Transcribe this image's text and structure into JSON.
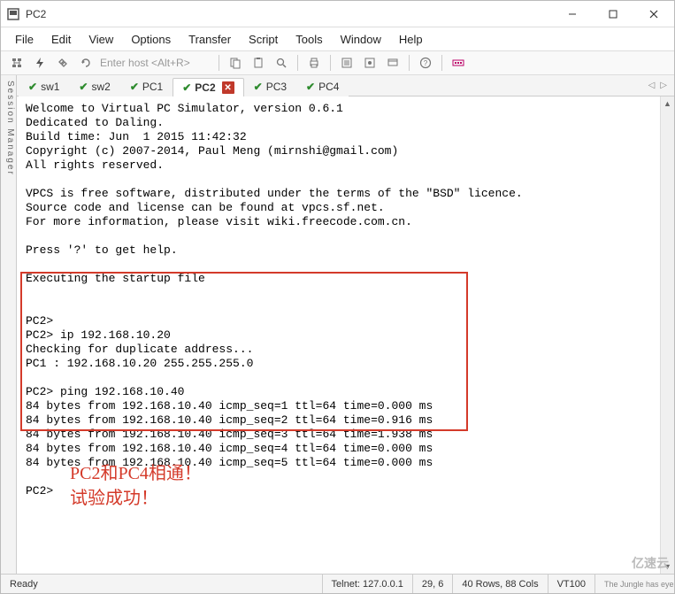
{
  "window": {
    "title": "PC2",
    "buttons": {
      "min": "min",
      "max": "max",
      "close": "close"
    }
  },
  "menu": {
    "items": [
      "File",
      "Edit",
      "View",
      "Options",
      "Transfer",
      "Script",
      "Tools",
      "Window",
      "Help"
    ]
  },
  "toolbar": {
    "host_placeholder": "Enter host <Alt+R>",
    "icons": [
      "session-tree",
      "lightning",
      "disconnect",
      "reconnect"
    ]
  },
  "session_manager_label": "Session Manager",
  "tabs": [
    {
      "label": "sw1",
      "check": true,
      "active": false,
      "close": false
    },
    {
      "label": "sw2",
      "check": true,
      "active": false,
      "close": false
    },
    {
      "label": "PC1",
      "check": true,
      "active": false,
      "close": false
    },
    {
      "label": "PC2",
      "check": true,
      "active": true,
      "close": true
    },
    {
      "label": "PC3",
      "check": true,
      "active": false,
      "close": false
    },
    {
      "label": "PC4",
      "check": true,
      "active": false,
      "close": false
    }
  ],
  "terminal": {
    "text": "Welcome to Virtual PC Simulator, version 0.6.1\nDedicated to Daling.\nBuild time: Jun  1 2015 11:42:32\nCopyright (c) 2007-2014, Paul Meng (mirnshi@gmail.com)\nAll rights reserved.\n\nVPCS is free software, distributed under the terms of the \"BSD\" licence.\nSource code and license can be found at vpcs.sf.net.\nFor more information, please visit wiki.freecode.com.cn.\n\nPress '?' to get help.\n\nExecuting the startup file\n\n\nPC2>\nPC2> ip 192.168.10.20\nChecking for duplicate address...\nPC1 : 192.168.10.20 255.255.255.0\n\nPC2> ping 192.168.10.40\n84 bytes from 192.168.10.40 icmp_seq=1 ttl=64 time=0.000 ms\n84 bytes from 192.168.10.40 icmp_seq=2 ttl=64 time=0.916 ms\n84 bytes from 192.168.10.40 icmp_seq=3 ttl=64 time=1.938 ms\n84 bytes from 192.168.10.40 icmp_seq=4 ttl=64 time=0.000 ms\n84 bytes from 192.168.10.40 icmp_seq=5 ttl=64 time=0.000 ms\n\nPC2>"
  },
  "annotation": {
    "line1": "PC2和PC4相通！",
    "line2": "试验成功！"
  },
  "statusbar": {
    "ready": "Ready",
    "conn": "Telnet: 127.0.0.1",
    "cursor": "29,   6",
    "size": "40 Rows, 88 Cols",
    "term": "VT100",
    "truncated": "The Jungle has eye"
  },
  "watermark": "亿速云"
}
